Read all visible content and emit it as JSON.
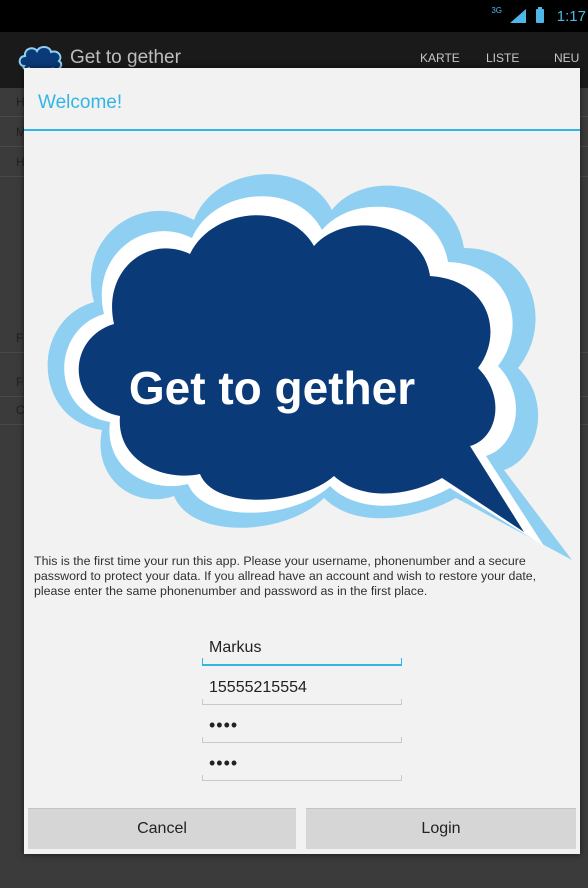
{
  "statusbar": {
    "network": "3G",
    "time": "1:17"
  },
  "actionbar": {
    "title": "Get to gether",
    "tabs": [
      "KARTE",
      "LISTE",
      "NEU"
    ],
    "logo_icon": "cloud-logo-icon"
  },
  "background_rows": [
    "H",
    "M",
    "H",
    "F",
    "F",
    "C"
  ],
  "dialog": {
    "title": "Welcome!",
    "logo_text": "Get to gether",
    "message": "This is the first time your run this app. Please your username, phonenumber and a secure password to protect your data. If you allread have an account and wish to restore your date, please enter the same phonenumber and password as in the first place.",
    "username": "Markus",
    "phone": "15555215554",
    "password": "••••",
    "password_confirm": "••••",
    "cancel_label": "Cancel",
    "login_label": "Login"
  },
  "colors": {
    "accent": "#33b5e5",
    "cloud_fill": "#0b3a78",
    "cloud_outline": "#8fd0f2"
  }
}
